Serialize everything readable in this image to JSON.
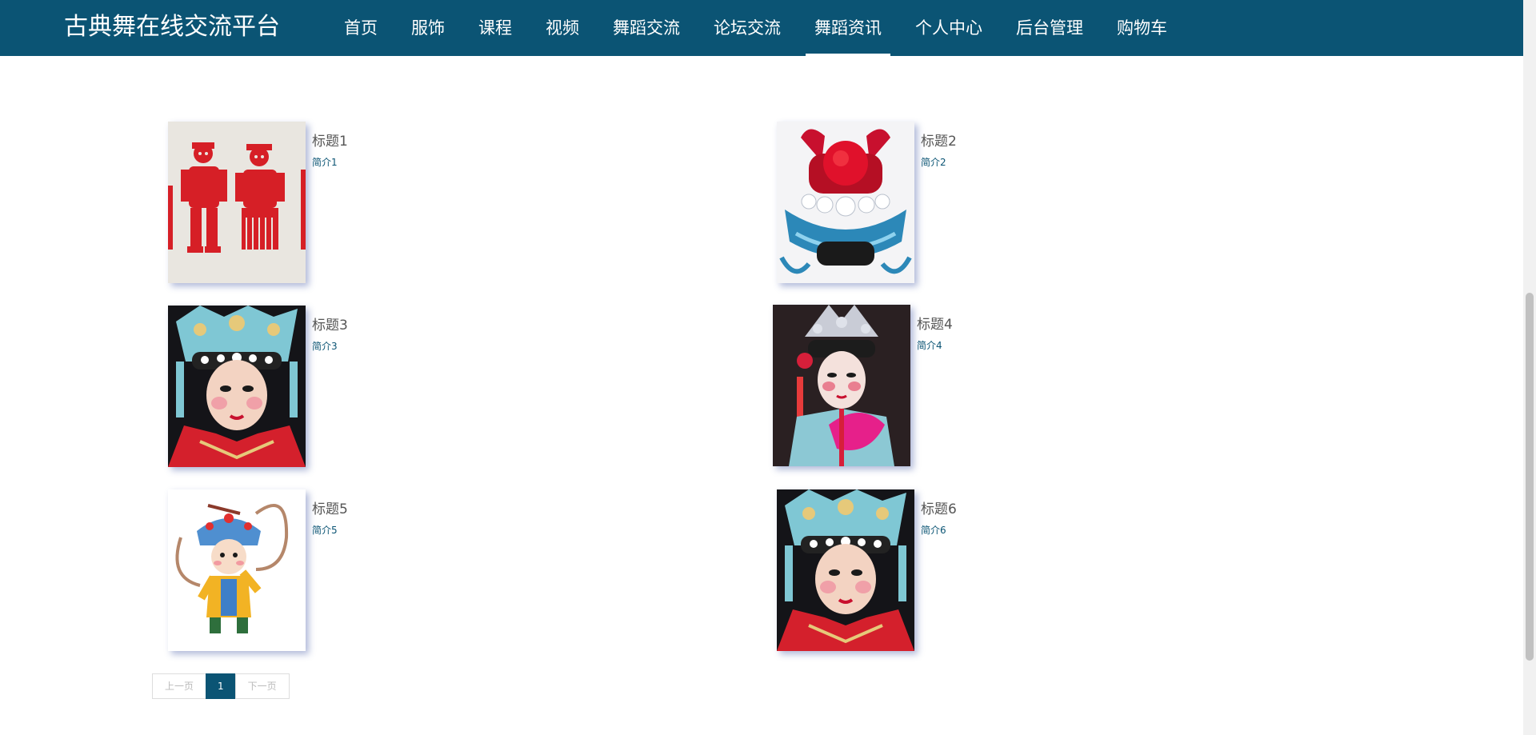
{
  "app": {
    "title": "古典舞在线交流平台"
  },
  "nav": {
    "items": [
      "首页",
      "服饰",
      "课程",
      "视频",
      "舞蹈交流",
      "论坛交流",
      "舞蹈资讯",
      "个人中心",
      "后台管理",
      "购物车"
    ],
    "active": "舞蹈资讯"
  },
  "news": [
    {
      "title": "标题1",
      "desc": "简介1",
      "image": "red paper-cut figures"
    },
    {
      "title": "标题2",
      "desc": "简介2",
      "image": "opera headdress with red pompom"
    },
    {
      "title": "标题3",
      "desc": "简介3",
      "image": "opera performer with phoenix crown"
    },
    {
      "title": "标题4",
      "desc": "简介4",
      "image": "opera performer with pink fan"
    },
    {
      "title": "标题5",
      "desc": "简介5",
      "image": "cartoon opera character"
    },
    {
      "title": "标题6",
      "desc": "简介6",
      "image": "opera performer with phoenix crown"
    }
  ],
  "pagination": {
    "prev_label": "上一页",
    "current_page": "1",
    "next_label": "下一页"
  },
  "colors": {
    "header_bg": "#0b5474",
    "accent": "#0b5474"
  }
}
